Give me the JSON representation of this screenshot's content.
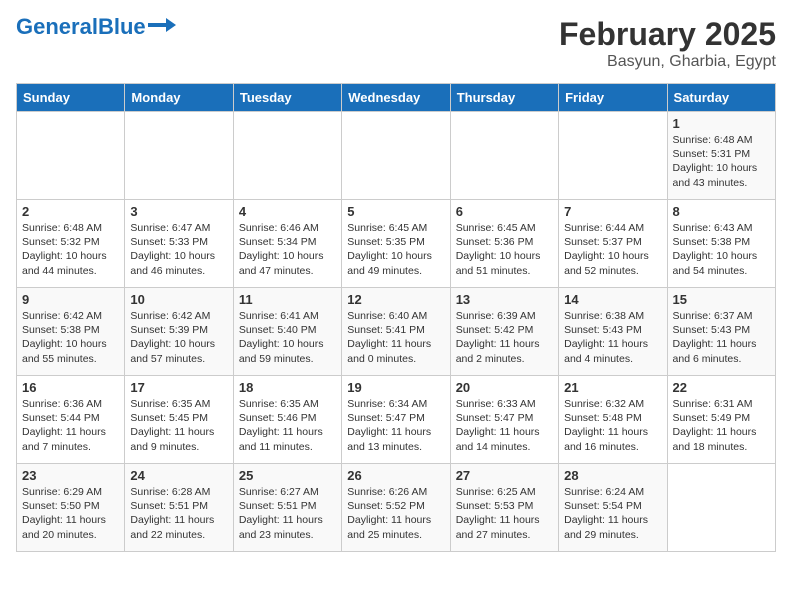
{
  "header": {
    "logo_general": "General",
    "logo_blue": "Blue",
    "title": "February 2025",
    "subtitle": "Basyun, Gharbia, Egypt"
  },
  "days_of_week": [
    "Sunday",
    "Monday",
    "Tuesday",
    "Wednesday",
    "Thursday",
    "Friday",
    "Saturday"
  ],
  "weeks": [
    [
      {
        "day": "",
        "info": ""
      },
      {
        "day": "",
        "info": ""
      },
      {
        "day": "",
        "info": ""
      },
      {
        "day": "",
        "info": ""
      },
      {
        "day": "",
        "info": ""
      },
      {
        "day": "",
        "info": ""
      },
      {
        "day": "1",
        "info": "Sunrise: 6:48 AM\nSunset: 5:31 PM\nDaylight: 10 hours and 43 minutes."
      }
    ],
    [
      {
        "day": "2",
        "info": "Sunrise: 6:48 AM\nSunset: 5:32 PM\nDaylight: 10 hours and 44 minutes."
      },
      {
        "day": "3",
        "info": "Sunrise: 6:47 AM\nSunset: 5:33 PM\nDaylight: 10 hours and 46 minutes."
      },
      {
        "day": "4",
        "info": "Sunrise: 6:46 AM\nSunset: 5:34 PM\nDaylight: 10 hours and 47 minutes."
      },
      {
        "day": "5",
        "info": "Sunrise: 6:45 AM\nSunset: 5:35 PM\nDaylight: 10 hours and 49 minutes."
      },
      {
        "day": "6",
        "info": "Sunrise: 6:45 AM\nSunset: 5:36 PM\nDaylight: 10 hours and 51 minutes."
      },
      {
        "day": "7",
        "info": "Sunrise: 6:44 AM\nSunset: 5:37 PM\nDaylight: 10 hours and 52 minutes."
      },
      {
        "day": "8",
        "info": "Sunrise: 6:43 AM\nSunset: 5:38 PM\nDaylight: 10 hours and 54 minutes."
      }
    ],
    [
      {
        "day": "9",
        "info": "Sunrise: 6:42 AM\nSunset: 5:38 PM\nDaylight: 10 hours and 55 minutes."
      },
      {
        "day": "10",
        "info": "Sunrise: 6:42 AM\nSunset: 5:39 PM\nDaylight: 10 hours and 57 minutes."
      },
      {
        "day": "11",
        "info": "Sunrise: 6:41 AM\nSunset: 5:40 PM\nDaylight: 10 hours and 59 minutes."
      },
      {
        "day": "12",
        "info": "Sunrise: 6:40 AM\nSunset: 5:41 PM\nDaylight: 11 hours and 0 minutes."
      },
      {
        "day": "13",
        "info": "Sunrise: 6:39 AM\nSunset: 5:42 PM\nDaylight: 11 hours and 2 minutes."
      },
      {
        "day": "14",
        "info": "Sunrise: 6:38 AM\nSunset: 5:43 PM\nDaylight: 11 hours and 4 minutes."
      },
      {
        "day": "15",
        "info": "Sunrise: 6:37 AM\nSunset: 5:43 PM\nDaylight: 11 hours and 6 minutes."
      }
    ],
    [
      {
        "day": "16",
        "info": "Sunrise: 6:36 AM\nSunset: 5:44 PM\nDaylight: 11 hours and 7 minutes."
      },
      {
        "day": "17",
        "info": "Sunrise: 6:35 AM\nSunset: 5:45 PM\nDaylight: 11 hours and 9 minutes."
      },
      {
        "day": "18",
        "info": "Sunrise: 6:35 AM\nSunset: 5:46 PM\nDaylight: 11 hours and 11 minutes."
      },
      {
        "day": "19",
        "info": "Sunrise: 6:34 AM\nSunset: 5:47 PM\nDaylight: 11 hours and 13 minutes."
      },
      {
        "day": "20",
        "info": "Sunrise: 6:33 AM\nSunset: 5:47 PM\nDaylight: 11 hours and 14 minutes."
      },
      {
        "day": "21",
        "info": "Sunrise: 6:32 AM\nSunset: 5:48 PM\nDaylight: 11 hours and 16 minutes."
      },
      {
        "day": "22",
        "info": "Sunrise: 6:31 AM\nSunset: 5:49 PM\nDaylight: 11 hours and 18 minutes."
      }
    ],
    [
      {
        "day": "23",
        "info": "Sunrise: 6:29 AM\nSunset: 5:50 PM\nDaylight: 11 hours and 20 minutes."
      },
      {
        "day": "24",
        "info": "Sunrise: 6:28 AM\nSunset: 5:51 PM\nDaylight: 11 hours and 22 minutes."
      },
      {
        "day": "25",
        "info": "Sunrise: 6:27 AM\nSunset: 5:51 PM\nDaylight: 11 hours and 23 minutes."
      },
      {
        "day": "26",
        "info": "Sunrise: 6:26 AM\nSunset: 5:52 PM\nDaylight: 11 hours and 25 minutes."
      },
      {
        "day": "27",
        "info": "Sunrise: 6:25 AM\nSunset: 5:53 PM\nDaylight: 11 hours and 27 minutes."
      },
      {
        "day": "28",
        "info": "Sunrise: 6:24 AM\nSunset: 5:54 PM\nDaylight: 11 hours and 29 minutes."
      },
      {
        "day": "",
        "info": ""
      }
    ]
  ]
}
